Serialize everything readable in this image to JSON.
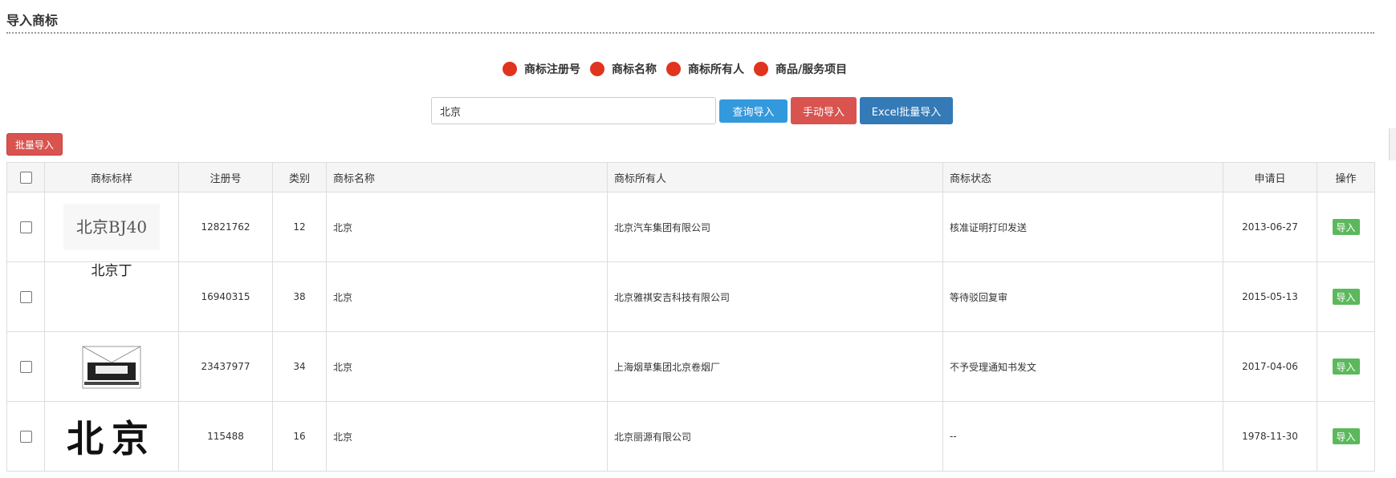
{
  "header": {
    "title": "导入商标"
  },
  "search_options": [
    {
      "label": "商标注册号",
      "color": "#e0341e"
    },
    {
      "label": "商标名称",
      "color": "#e0341e"
    },
    {
      "label": "商标所有人",
      "color": "#e0341e"
    },
    {
      "label": "商品/服务项目",
      "color": "#e0341e"
    }
  ],
  "search": {
    "value": "北京"
  },
  "buttons": {
    "query": "查询导入",
    "manual": "手动导入",
    "excel": "Excel批量导入",
    "batch": "批量导入",
    "query_color": "#3399dd",
    "manual_color": "#d9534f",
    "excel_color": "#337ab7"
  },
  "table": {
    "headers": {
      "sample": "商标标样",
      "reg_no": "注册号",
      "class": "类别",
      "name": "商标名称",
      "owner": "商标所有人",
      "status": "商标状态",
      "apply_date": "申请日",
      "action": "操作"
    },
    "rows": [
      {
        "thumb_text": "北京BJ40",
        "reg_no": "12821762",
        "class": "12",
        "name": "北京",
        "owner": "北京汽车集团有限公司",
        "status": "核准证明打印发送",
        "apply_date": "2013-06-27",
        "action": "导入"
      },
      {
        "thumb_text": "北京丁",
        "reg_no": "16940315",
        "class": "38",
        "name": "北京",
        "owner": "北京雅祺安吉科技有限公司",
        "status": "等待驳回复审",
        "apply_date": "2015-05-13",
        "action": "导入"
      },
      {
        "thumb_text": "",
        "reg_no": "23437977",
        "class": "34",
        "name": "北京",
        "owner": "上海烟草集团北京卷烟厂",
        "status": "不予受理通知书发文",
        "apply_date": "2017-04-06",
        "action": "导入"
      },
      {
        "thumb_text": "北京",
        "reg_no": "115488",
        "class": "16",
        "name": "北京",
        "owner": "北京丽源有限公司",
        "status": "--",
        "apply_date": "1978-11-30",
        "action": "导入"
      }
    ]
  },
  "icons": {
    "option_dot": "filled-circle",
    "checkbox": "checkbox-unchecked"
  }
}
